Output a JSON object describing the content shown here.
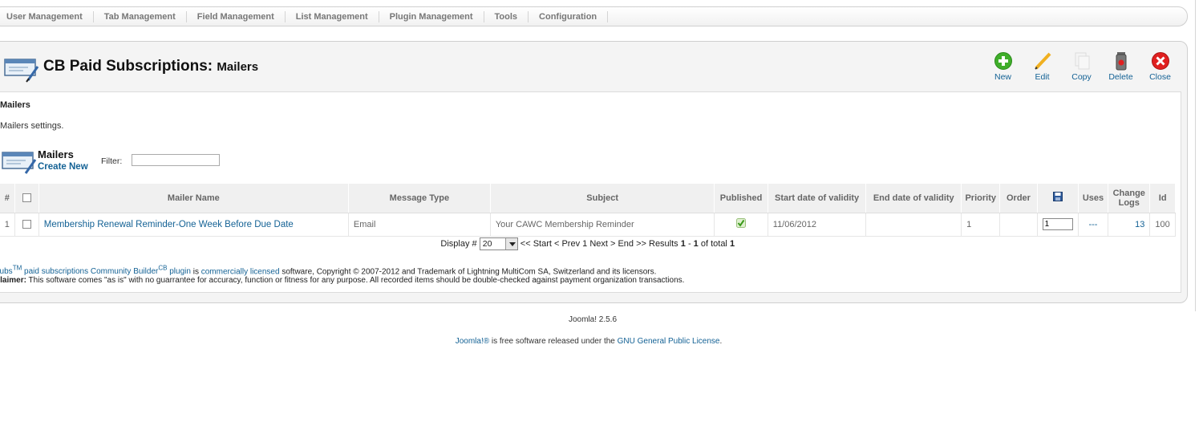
{
  "menu": [
    "User Management",
    "Tab Management",
    "Field Management",
    "List Management",
    "Plugin Management",
    "Tools",
    "Configuration"
  ],
  "title": {
    "main": "CB Paid Subscriptions:",
    "sub": "Mailers"
  },
  "toolbar": {
    "new": "New",
    "edit": "Edit",
    "copy": "Copy",
    "delete": "Delete",
    "close": "Close"
  },
  "section": {
    "title": "Mailers",
    "desc": "Mailers settings."
  },
  "list": {
    "heading": "Mailers",
    "create": "Create New",
    "filter_label": "Filter:",
    "filter_value": ""
  },
  "columns": [
    "#",
    "Mailer Name",
    "Message Type",
    "Subject",
    "Published",
    "Start date of validity",
    "End date of validity",
    "Priority",
    "Order",
    "Uses",
    "Change Logs",
    "Id"
  ],
  "rows": [
    {
      "num": "1",
      "name": "Membership Renewal Reminder-One Week Before Due Date",
      "type": "Email",
      "subject": "Your CAWC Membership Reminder",
      "start": "11/06/2012",
      "end": "",
      "priority": "1",
      "order": "1",
      "uses": "---",
      "logs": "13",
      "id": "100"
    }
  ],
  "pager": {
    "display_label": "Display #",
    "display_value": "20",
    "nav": "<< Start < Prev 1 Next > End >> Results",
    "range_start": "1",
    "range_sep": "-",
    "range_end": "1",
    "of_total": "of total",
    "total": "1"
  },
  "footer": {
    "cbsubs": "CBSubs",
    "tm": "TM",
    "paid": "paid subscriptions",
    "community": "Community Builder",
    "cb": "CB",
    "plugin": "plugin",
    "is": "is",
    "commercial": "commercially licensed",
    "rest": "software, Copyright © 2007-2012 and Trademark of Lightning MultiCom SA, Switzerland and its licensors.",
    "disclaimer_label": "Disclaimer:",
    "disclaimer": "This software comes \"as is\" with no guarrantee for accuracy, function or fitness for any purpose. All recorded items should be double-checked against payment organization transactions."
  },
  "version": "Joomla! 2.5.6",
  "gpl": {
    "joomla": "Joomla!®",
    "mid": "is free software released under the",
    "license": "GNU General Public License",
    "end": "."
  },
  "colors": {
    "link": "#146295",
    "new": "#3fae2a",
    "close": "#e02020"
  }
}
